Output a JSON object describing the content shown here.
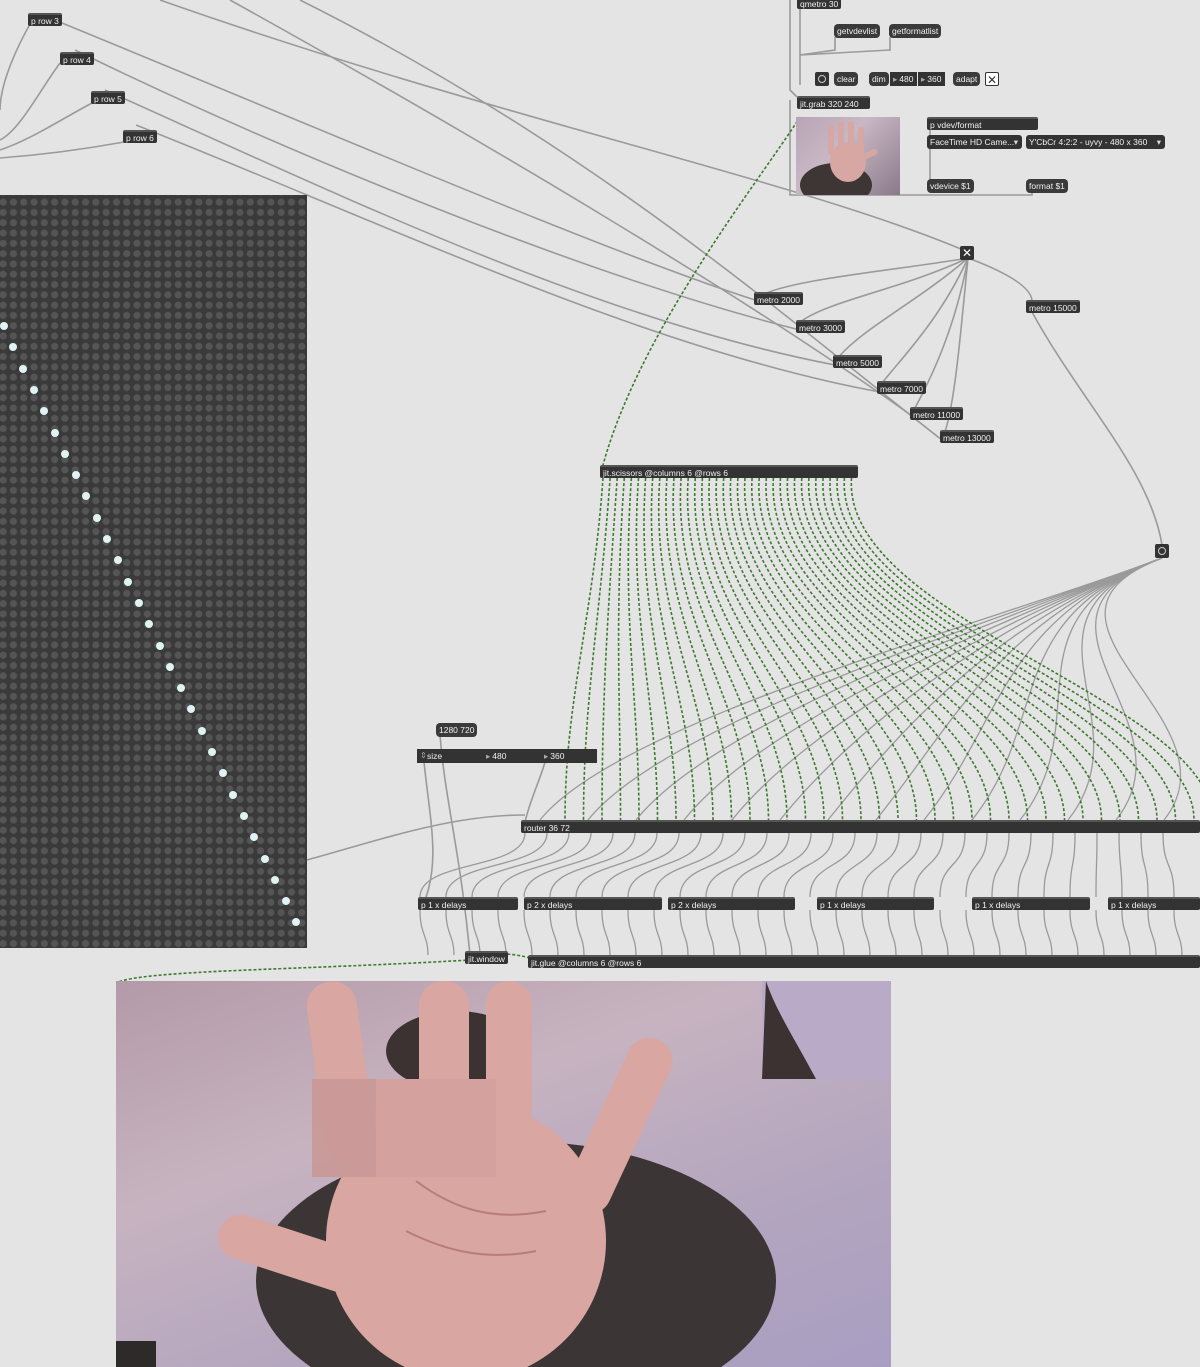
{
  "subpatchers": {
    "row3": "p row 3",
    "row4": "p row 4",
    "row5": "p row 5",
    "row6": "p row 6",
    "vdev_format": "p vdev/format"
  },
  "top_controls": {
    "qmetro": "qmetro 30",
    "getvdevlist": "getvdevlist",
    "getformatlist": "getformatlist",
    "clear": "clear",
    "dim": "dim",
    "dim_w": "480",
    "dim_h": "360",
    "adapt": "adapt",
    "adapt_toggle": "✕",
    "jit_grab": "jit.grab 320 240",
    "device_menu": "FaceTime HD Came...",
    "format_menu": "Y'CbCr 4:2:2 - uyvy - 480 x 360",
    "vdevice_msg": "vdevice $1",
    "format_msg": "format $1"
  },
  "main_toggle": "✕",
  "metros": [
    "metro 2000",
    "metro 3000",
    "metro 5000",
    "metro 7000",
    "metro 11000",
    "metro 13000",
    "metro 15000"
  ],
  "processing": {
    "scissors": "jit.scissors @columns 6 @rows 6",
    "size_msg_1": "1280 720",
    "size_label": "size",
    "size_w": "480",
    "size_h": "360",
    "router": "router 36 72",
    "jit_window": "jit.window",
    "glue": "jit.glue @columns 6 @rows 6"
  },
  "delays": [
    "p 1 x delays",
    "p 2 x delays",
    "p 2 x delays",
    "p 1 x delays",
    "p 1 x delays",
    "p 1 x delays"
  ],
  "matrixctrl": {
    "grid_color": "#3a3a3a",
    "off_color": "#555555",
    "on_color": "#dff3f4"
  },
  "colors": {
    "background": "#e4e4e4",
    "object": "#333333",
    "patch_cord": "#9a9a9a",
    "matrix_cord": "#3c7a2e"
  }
}
